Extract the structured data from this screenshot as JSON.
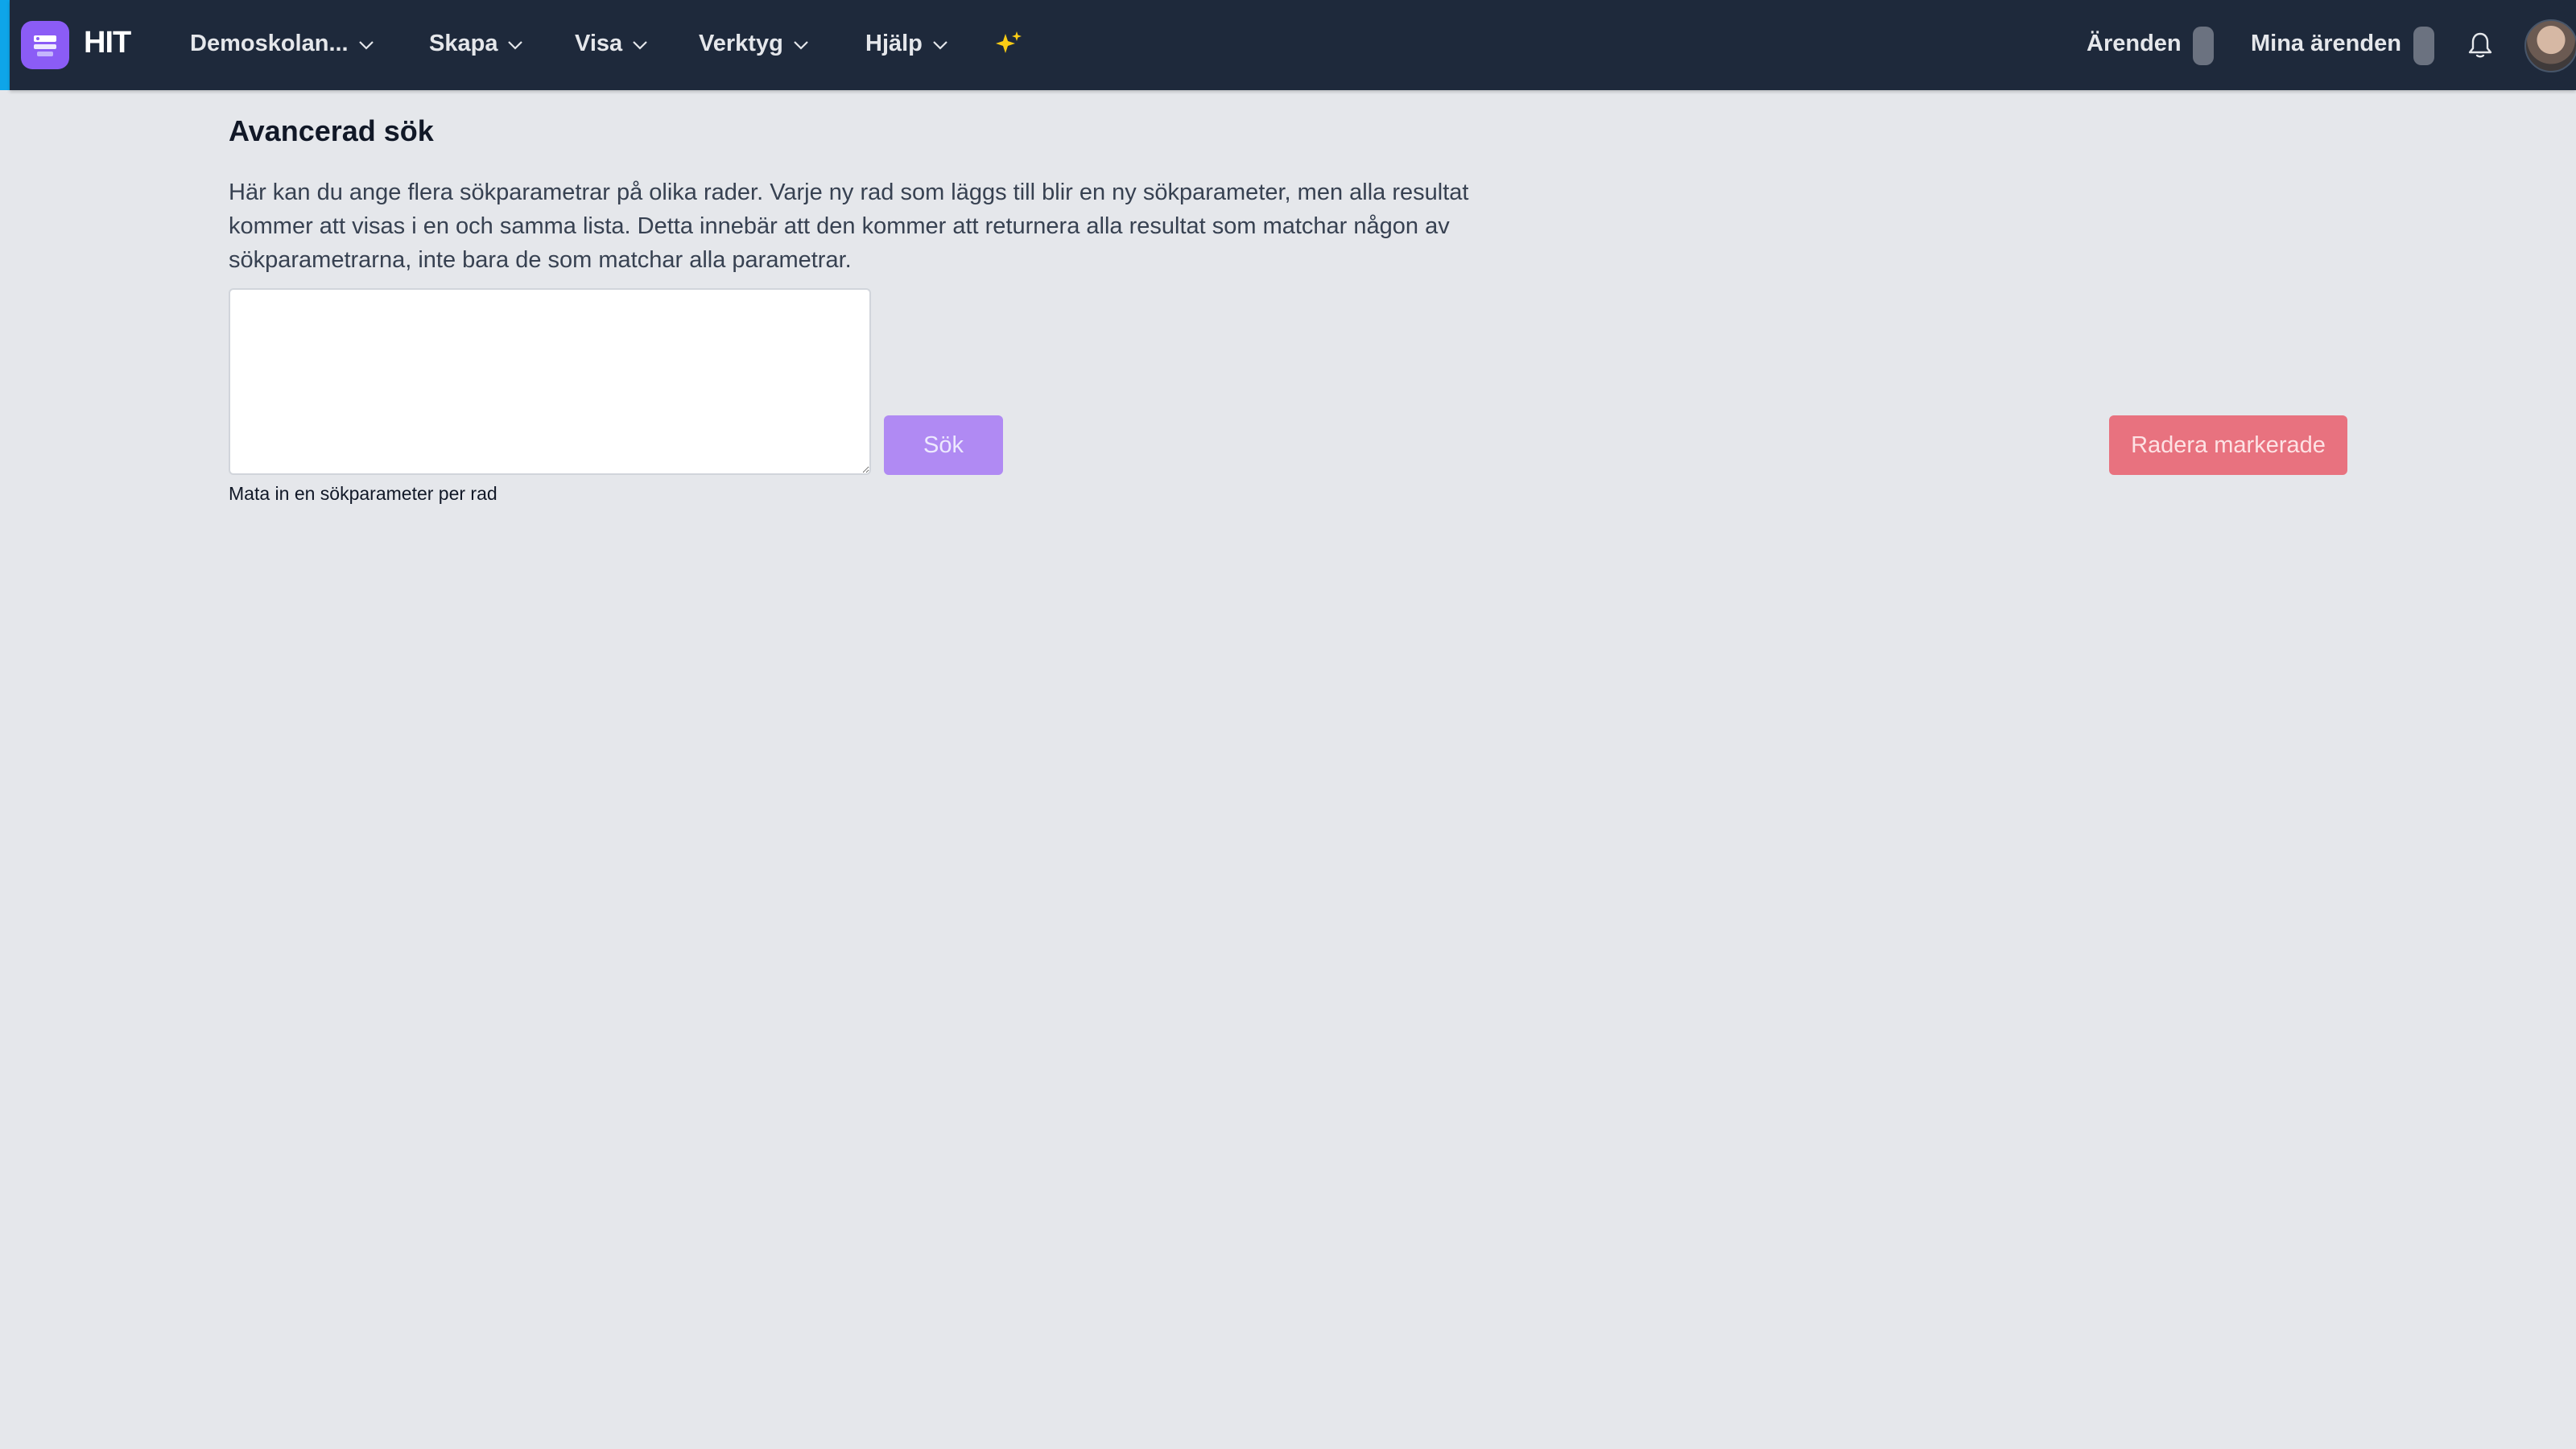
{
  "app": {
    "name": "HIT"
  },
  "nav": {
    "items": [
      {
        "label": "Demoskolan...",
        "icon": "chevron-down-icon"
      },
      {
        "label": "Skapa",
        "icon": "chevron-down-icon"
      },
      {
        "label": "Visa",
        "icon": "chevron-down-icon"
      },
      {
        "label": "Verktyg",
        "icon": "chevron-down-icon"
      },
      {
        "label": "Hjälp",
        "icon": "chevron-down-icon"
      }
    ],
    "sparkle_icon": "sparkles-icon"
  },
  "header_right": {
    "tickets_label": "Ärenden",
    "my_tickets_label": "Mina ärenden",
    "notification_icon": "bell-icon"
  },
  "main": {
    "title": "Avancerad sök",
    "description": "Här kan du ange flera sökparametrar på olika rader. Varje ny rad som läggs till blir en ny sökparameter, men alla resultat kommer att visas i en och samma lista. Detta innebär att den kommer att returnera alla resultat som matchar någon av sökparametrarna, inte bara de som matchar alla parametrar.",
    "search_input": {
      "value": "",
      "helper": "Mata in en sökparameter per rad"
    },
    "search_button": "Sök",
    "delete_button": "Radera markerade"
  },
  "colors": {
    "topbar": "#1e293b",
    "accent": "#0ea5e9",
    "brand": "#8b5cf6",
    "search_button": "#b08af3",
    "delete_button": "#e8727f",
    "sparkle": "#facc15"
  }
}
